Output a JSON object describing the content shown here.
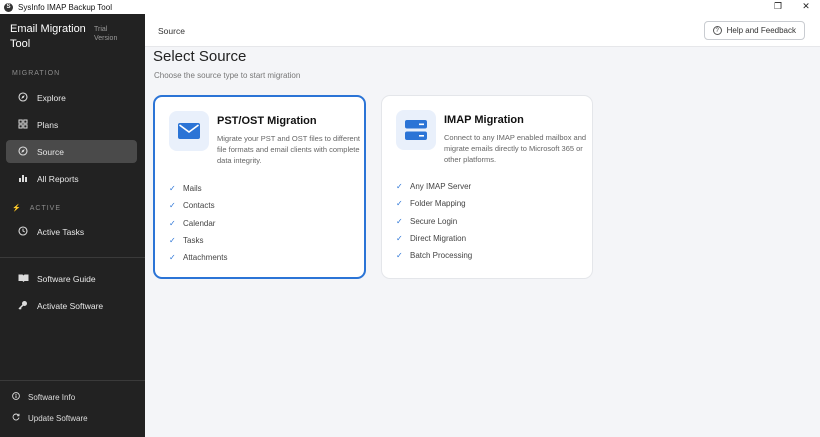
{
  "window": {
    "title": "SysInfo IMAP Backup Tool",
    "app_icon": "S",
    "controls": [
      "❐",
      "✕"
    ]
  },
  "sidebar": {
    "brand": "Email Migration Tool",
    "trial": "Trial Version",
    "section_migration": "MIGRATION",
    "section_active": "ACTIVE",
    "items": [
      {
        "label": "Explore",
        "icon": "compass-icon"
      },
      {
        "label": "Plans",
        "icon": "grid-icon"
      },
      {
        "label": "Source",
        "icon": "compass-icon"
      },
      {
        "label": "All Reports",
        "icon": "bar-chart-icon"
      }
    ],
    "active_items": [
      {
        "label": "Active Tasks",
        "icon": "clock-icon"
      }
    ],
    "tools": [
      {
        "label": "Software Guide",
        "icon": "book-icon"
      },
      {
        "label": "Activate Software",
        "icon": "key-icon"
      }
    ],
    "footer": [
      {
        "label": "Software Info",
        "icon": "info-icon"
      },
      {
        "label": "Update Software",
        "icon": "refresh-icon"
      }
    ]
  },
  "header": {
    "breadcrumb": "Source",
    "help_label": "Help and Feedback"
  },
  "main": {
    "title": "Select Source",
    "subtitle": "Choose the source type to start migration",
    "cards": [
      {
        "title": "PST/OST Migration",
        "desc": "Migrate your PST and OST files to different file formats and email clients with complete data integrity.",
        "icon": "mail-icon",
        "features": [
          "Mails",
          "Contacts",
          "Calendar",
          "Tasks",
          "Attachments"
        ]
      },
      {
        "title": "IMAP Migration",
        "desc": "Connect to any IMAP enabled mailbox and migrate emails directly to Microsoft 365 or other platforms.",
        "icon": "server-icon",
        "features": [
          "Any IMAP Server",
          "Folder Mapping",
          "Secure Login",
          "Direct Migration",
          "Batch Processing"
        ]
      }
    ]
  },
  "colors": {
    "sidebar_bg": "#222222",
    "accent": "#2b74d6",
    "page_bg": "#f4f5f8"
  }
}
